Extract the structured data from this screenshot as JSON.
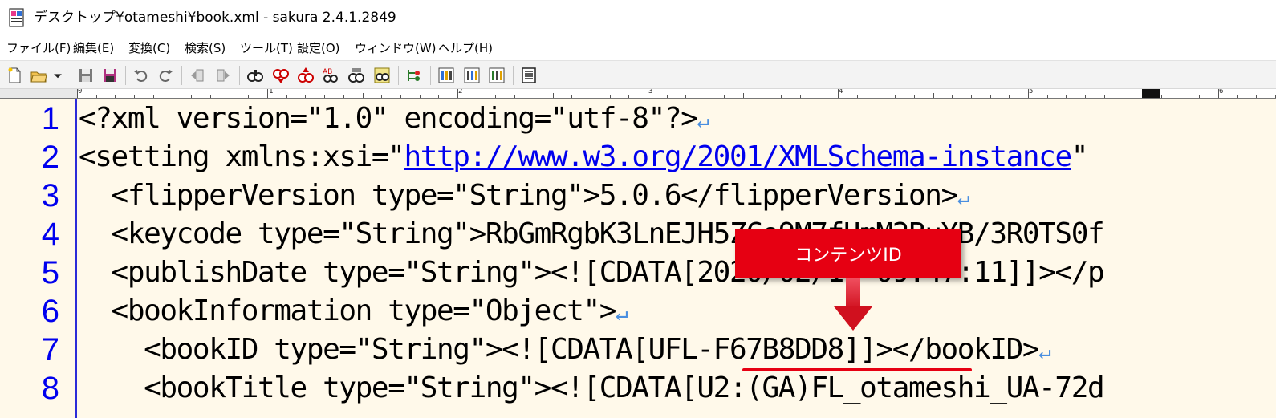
{
  "window": {
    "title": "デスクトップ¥otameshi¥book.xml - sakura 2.4.1.2849"
  },
  "menu": [
    "ファイル(F)",
    "編集(E)",
    "変換(C)",
    "検索(S)",
    "ツール(T)",
    "設定(O)",
    "ウィンドウ(W)",
    "ヘルプ(H)"
  ],
  "ruler": {
    "labels": [
      "0",
      "1",
      "2",
      "3",
      "4",
      "5",
      "6"
    ]
  },
  "editor": {
    "line_numbers": [
      "1",
      "2",
      "3",
      "4",
      "5",
      "6",
      "7",
      "8"
    ],
    "lines": [
      {
        "pre": "<?xml version=\"1.0\" encoding=\"utf-8\"?>",
        "url": "",
        "post": ""
      },
      {
        "pre": "<setting xmlns:xsi=\"",
        "url": "http://www.w3.org/2001/XMLSchema-instance",
        "post": "\""
      },
      {
        "pre": "  <flipperVersion type=\"String\">5.0.6</flipperVersion>",
        "url": "",
        "post": ""
      },
      {
        "pre": "  <keycode type=\"String\">RbGmRgbK3LnEJH5ZCo9M7fUmM2BuYB/3R0TS0f",
        "url": "",
        "post": ""
      },
      {
        "pre": "  <publishDate type=\"String\"><![CDATA[2020/02/10 09:47:11]]></p",
        "url": "",
        "post": ""
      },
      {
        "pre": "  <bookInformation type=\"Object\">",
        "url": "",
        "post": ""
      },
      {
        "pre": "    <bookID type=\"String\"><![CDATA[UFL-F67B8DD8]]></bookID>",
        "url": "",
        "post": ""
      },
      {
        "pre": "    <bookTitle type=\"String\"><![CDATA[U2:(GA)FL_otameshi_UA-72d",
        "url": "",
        "post": ""
      }
    ],
    "eol_mark": "↵",
    "eol_lines": [
      true,
      false,
      true,
      false,
      false,
      true,
      true,
      false
    ]
  },
  "annotation": {
    "label": "コンテンツID",
    "color": "#e60012"
  },
  "colors": {
    "editor_bg": "#fff9ea",
    "line_number": "#0000ee",
    "url": "#0000ee",
    "eol": "#4a8fe0"
  }
}
